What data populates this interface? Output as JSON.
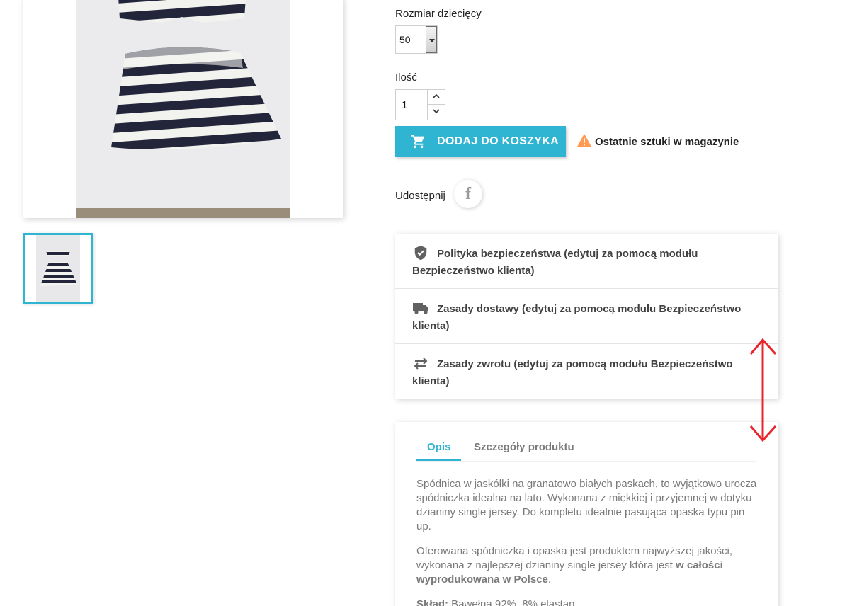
{
  "product": {
    "size_label": "Rozmiar dziecięcy",
    "size_selected": "50",
    "qty_label": "Ilość",
    "qty_value": "1",
    "add_to_cart": "DODAJ DO KOSZYKA",
    "stock_note": "Ostatnie sztuki w magazynie",
    "share_label": "Udostępnij",
    "share_icon": "facebook-icon",
    "facebook_glyph": "f"
  },
  "reassurance": [
    {
      "icon": "shield-check-icon",
      "text": "Polityka bezpieczeństwa (edytuj za pomocą modułu Bezpieczeństwo klienta)"
    },
    {
      "icon": "truck-icon",
      "text": "Zasady dostawy (edytuj za pomocą modułu Bezpieczeństwo klienta)"
    },
    {
      "icon": "swap-arrows-icon",
      "text": "Zasady zwrotu (edytuj za pomocą modułu Bezpieczeństwo klienta)"
    }
  ],
  "tabs": {
    "items": [
      {
        "label": "Opis",
        "active": true
      },
      {
        "label": "Szczegóły produktu",
        "active": false
      }
    ],
    "description": {
      "p1": "Spódnica w jaskółki na granatowo białych paskach, to wyjątkowo urocza spódniczka idealna na lato. Wykonana z miękkiej i przyjemnej w dotyku dzianiny single jersey. Do kompletu idealnie pasująca opaska typu pin up.",
      "p2_start": "Oferowana spódniczka i opaska jest produktem najwyższej jakości, wykonana z najlepszej dzianiny single jersey która jest ",
      "p2_bold": "w całości wyprodukowana w Polsce",
      "p2_end": ".",
      "p3_bold": "Skład:",
      "p3_rest": " Bawełna 92%, 8% elastan"
    }
  },
  "colors": {
    "accent": "#2fb5d2",
    "warning": "#ff9a52",
    "annotation": "#e8262b"
  }
}
